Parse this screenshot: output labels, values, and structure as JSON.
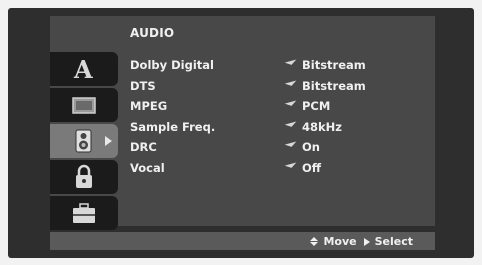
{
  "menu": {
    "title": "AUDIO",
    "rows": [
      {
        "label": "Dolby Digital",
        "value": "Bitstream"
      },
      {
        "label": "DTS",
        "value": "Bitstream"
      },
      {
        "label": "MPEG",
        "value": "PCM"
      },
      {
        "label": "Sample Freq.",
        "value": "48kHz"
      },
      {
        "label": "DRC",
        "value": "On"
      },
      {
        "label": "Vocal",
        "value": "Off"
      }
    ]
  },
  "sidebar": {
    "items": [
      {
        "name": "language-icon",
        "glyph": "A"
      },
      {
        "name": "display-icon"
      },
      {
        "name": "speaker-icon",
        "active": true
      },
      {
        "name": "lock-icon"
      },
      {
        "name": "toolbox-icon"
      }
    ]
  },
  "footer": {
    "move_label": "Move",
    "select_label": "Select"
  },
  "colors": {
    "background": "#2e2e2e",
    "panel": "#484848",
    "sidebar_item": "#1b1b1b",
    "sidebar_active": "#7a7a7a",
    "text": "#f0f0f0"
  }
}
